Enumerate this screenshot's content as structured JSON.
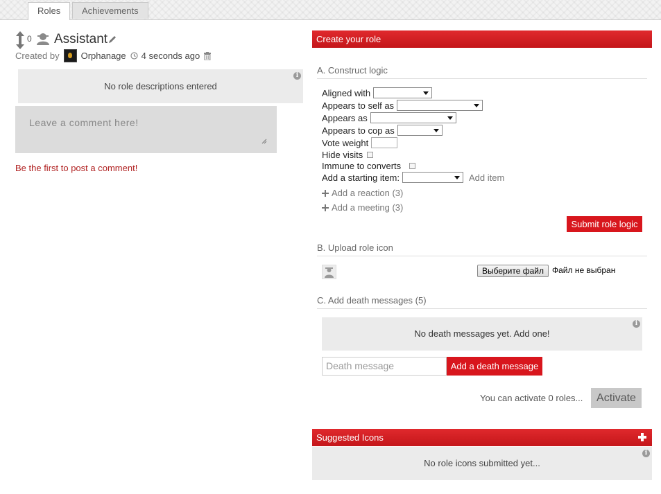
{
  "tabs": [
    {
      "label": "Roles",
      "active": true
    },
    {
      "label": "Achievements",
      "active": false
    }
  ],
  "role": {
    "vote_count": "0",
    "name": "Assistant",
    "created_by_label": "Created by",
    "creator": "Orphanage",
    "time_ago": "4 seconds ago",
    "description": "No role descriptions entered"
  },
  "comments": {
    "placeholder": "Leave a comment here!",
    "empty_text": "Be the first to post a comment!"
  },
  "create_panel": {
    "header": "Create your role",
    "section_a": "A. Construct logic",
    "fields": {
      "aligned_with": "Aligned with",
      "appears_to_self": "Appears to self as",
      "appears_as": "Appears as",
      "appears_to_cop": "Appears to cop as",
      "vote_weight": "Vote weight",
      "hide_visits": "Hide visits",
      "immune_to_converts": "Immune to converts",
      "starting_item": "Add a starting item:",
      "add_item": "Add item"
    },
    "add_reaction": "Add a reaction (3)",
    "add_meeting": "Add a meeting (3)",
    "submit_label": "Submit role logic",
    "section_b": "B. Upload role icon",
    "file_button": "Выберите файл",
    "file_status": "Файл не выбран",
    "section_c": "C. Add death messages (5)",
    "death_empty": "No death messages yet. Add one!",
    "death_placeholder": "Death message",
    "death_button": "Add a death message",
    "activate_text": "You can activate 0 roles...",
    "activate_button": "Activate"
  },
  "suggested": {
    "header": "Suggested Icons",
    "empty_text": "No role icons submitted yet..."
  },
  "colors": {
    "accent_red": "#d8161d",
    "comment_link": "#b02020",
    "panel_gray": "#ebebeb"
  },
  "icons": [
    "vote-arrows-icon",
    "user-silhouette-icon",
    "pencil-icon",
    "clock-icon",
    "trash-icon",
    "info-icon",
    "plus-icon",
    "resize-grip-icon"
  ]
}
